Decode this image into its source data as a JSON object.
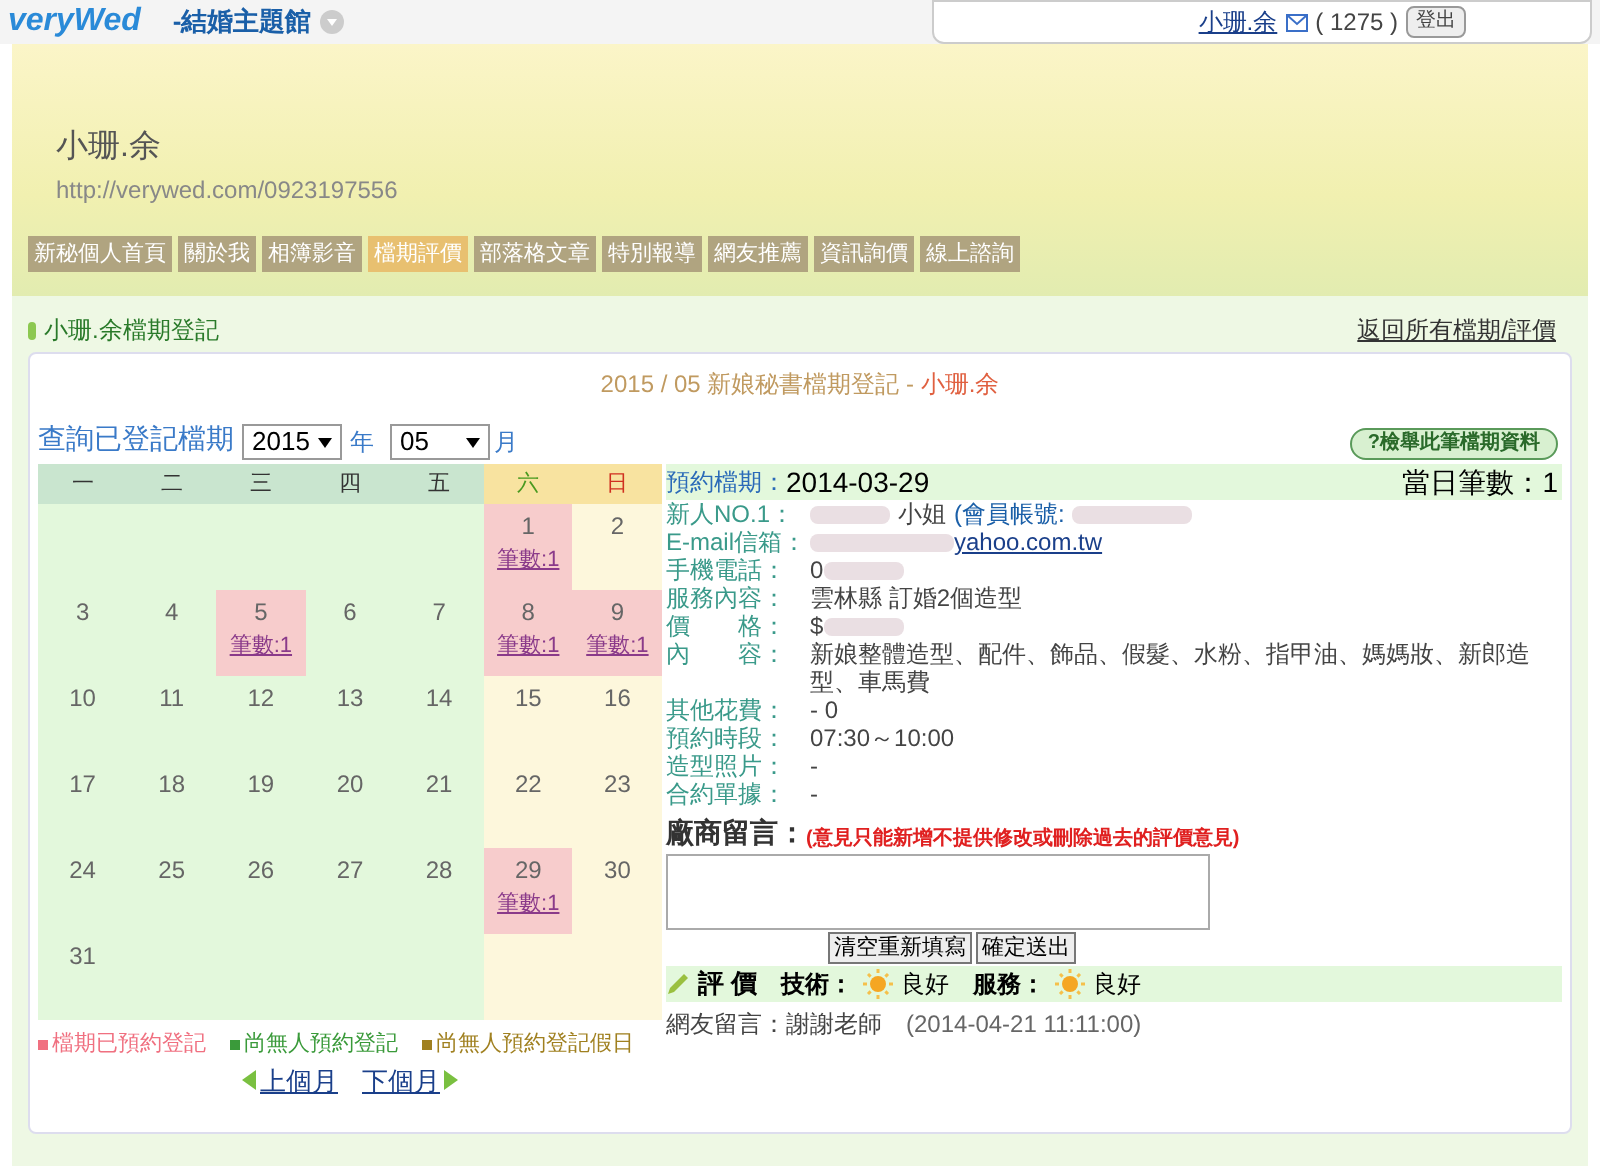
{
  "topbar": {
    "logo": "veryWed",
    "theme_menu": "-結婚主題館",
    "user": "小珊.余",
    "points": "( 1275 )",
    "logout": "登出"
  },
  "banner": {
    "name": "小珊.余",
    "url": "http://verywed.com/0923197556"
  },
  "nav": [
    {
      "label": "新秘個人首頁",
      "selected": false
    },
    {
      "label": "關於我",
      "selected": false
    },
    {
      "label": "相簿影音",
      "selected": false
    },
    {
      "label": "檔期評價",
      "selected": true
    },
    {
      "label": "部落格文章",
      "selected": false
    },
    {
      "label": "特別報導",
      "selected": false
    },
    {
      "label": "網友推薦",
      "selected": false
    },
    {
      "label": "資訊詢價",
      "selected": false
    },
    {
      "label": "線上諮詢",
      "selected": false
    }
  ],
  "section": {
    "title": "小珊.余檔期登記",
    "back_link": "返回所有檔期/評價"
  },
  "heading": {
    "period": "2015 / 05 新娘秘書檔期登記 - ",
    "name": "小珊.余"
  },
  "query": {
    "label": "查詢已登記檔期",
    "year": "2015",
    "year_unit": "年",
    "month": "05",
    "month_unit": "月"
  },
  "report_button": "?檢舉此筆檔期資料",
  "weekdays": [
    {
      "label": "一",
      "kind": "weekday"
    },
    {
      "label": "二",
      "kind": "weekday"
    },
    {
      "label": "三",
      "kind": "weekday"
    },
    {
      "label": "四",
      "kind": "weekday"
    },
    {
      "label": "五",
      "kind": "weekday"
    },
    {
      "label": "六",
      "kind": "saturday"
    },
    {
      "label": "日",
      "kind": "sunday"
    }
  ],
  "weeks": [
    [
      {
        "kind": "free"
      },
      {
        "kind": "free"
      },
      {
        "kind": "free"
      },
      {
        "kind": "free"
      },
      {
        "kind": "free"
      },
      {
        "kind": "booked",
        "day": "1",
        "count": "筆數:1"
      },
      {
        "kind": "holiday",
        "day": "2"
      }
    ],
    [
      {
        "kind": "free",
        "day": "3"
      },
      {
        "kind": "free",
        "day": "4"
      },
      {
        "kind": "booked",
        "day": "5",
        "count": "筆數:1"
      },
      {
        "kind": "free",
        "day": "6"
      },
      {
        "kind": "free",
        "day": "7"
      },
      {
        "kind": "booked",
        "day": "8",
        "count": "筆數:1"
      },
      {
        "kind": "booked",
        "day": "9",
        "count": "筆數:1"
      }
    ],
    [
      {
        "kind": "free",
        "day": "10"
      },
      {
        "kind": "free",
        "day": "11"
      },
      {
        "kind": "free",
        "day": "12"
      },
      {
        "kind": "free",
        "day": "13"
      },
      {
        "kind": "free",
        "day": "14"
      },
      {
        "kind": "holiday",
        "day": "15"
      },
      {
        "kind": "holiday",
        "day": "16"
      }
    ],
    [
      {
        "kind": "free",
        "day": "17"
      },
      {
        "kind": "free",
        "day": "18"
      },
      {
        "kind": "free",
        "day": "19"
      },
      {
        "kind": "free",
        "day": "20"
      },
      {
        "kind": "free",
        "day": "21"
      },
      {
        "kind": "holiday",
        "day": "22"
      },
      {
        "kind": "holiday",
        "day": "23"
      }
    ],
    [
      {
        "kind": "free",
        "day": "24"
      },
      {
        "kind": "free",
        "day": "25"
      },
      {
        "kind": "free",
        "day": "26"
      },
      {
        "kind": "free",
        "day": "27"
      },
      {
        "kind": "free",
        "day": "28"
      },
      {
        "kind": "booked",
        "day": "29",
        "count": "筆數:1"
      },
      {
        "kind": "holiday",
        "day": "30"
      }
    ],
    [
      {
        "kind": "free",
        "day": "31"
      },
      {
        "kind": "free"
      },
      {
        "kind": "free"
      },
      {
        "kind": "free"
      },
      {
        "kind": "free"
      },
      {
        "kind": "holiday"
      },
      {
        "kind": "holiday"
      }
    ]
  ],
  "legend": [
    {
      "label": "檔期已預約登記",
      "color": "#f07080"
    },
    {
      "label": "尚無人預約登記",
      "color": "#3a9a3a"
    },
    {
      "label": "尚無人預約登記假日",
      "color": "#a08020"
    }
  ],
  "month_nav": {
    "prev": "上個月",
    "next": "下個月"
  },
  "booking": {
    "date_label": "預約檔期：",
    "date": "2014-03-29",
    "count_label": "當日筆數：",
    "count": "1",
    "fields": [
      {
        "label": "新人NO.1：",
        "value": "小姐",
        "extra": "(會員帳號:",
        "kind": "member"
      },
      {
        "label": "E-mail信箱：",
        "value": "yahoo.com.tw",
        "kind": "email"
      },
      {
        "label": "手機電話：",
        "value": "0",
        "kind": "redacted"
      },
      {
        "label": "服務內容：",
        "value": "雲林縣 訂婚2個造型",
        "kind": "text"
      },
      {
        "label": "價　　格：",
        "value": "$",
        "kind": "redacted"
      },
      {
        "label": "內　　容：",
        "value": "新娘整體造型、配件、飾品、假髮、水粉、指甲油、媽媽妝、新郎造型、車馬費",
        "kind": "text"
      },
      {
        "label": "其他花費：",
        "value": "- 0",
        "kind": "text"
      },
      {
        "label": "預約時段：",
        "value": "07:30～10:00",
        "kind": "text"
      },
      {
        "label": "造型照片：",
        "value": "-",
        "kind": "text"
      },
      {
        "label": "合約單據：",
        "value": "-",
        "kind": "text"
      }
    ]
  },
  "vendor_comment": {
    "label": "廠商留言：",
    "note": "(意見只能新增不提供修改或刪除過去的評價意見)",
    "buttons": [
      "清空重新填寫",
      "確定送出"
    ]
  },
  "review": {
    "title": "評 價",
    "tech_label": "技術：",
    "tech": "良好",
    "service_label": "服務：",
    "service": "良好",
    "comment": "網友留言：謝謝老師",
    "time": "(2014-04-21 11:11:00)"
  }
}
